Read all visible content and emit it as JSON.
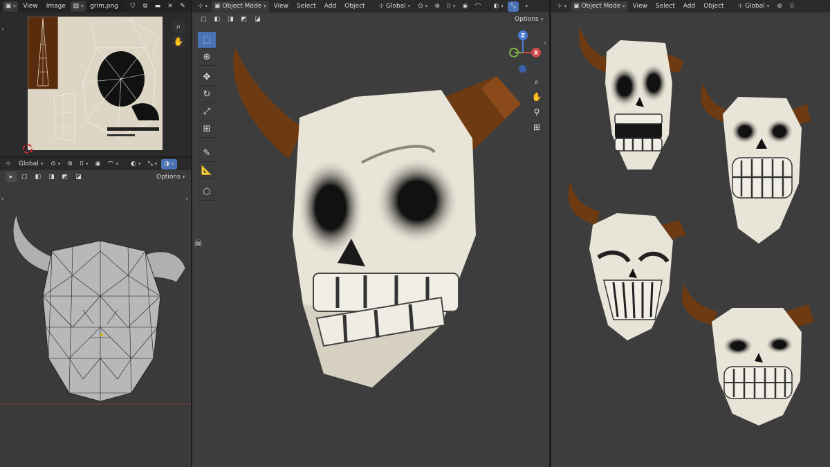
{
  "image_editor": {
    "menu": [
      "View",
      "Image"
    ],
    "image_name": "grim.png"
  },
  "uv_viewport": {
    "transform_orientation": "Global",
    "options_label": "Options"
  },
  "main_viewport": {
    "mode": "Object Mode",
    "menu": [
      "View",
      "Select",
      "Add",
      "Object"
    ],
    "transform_orientation": "Global",
    "options_label": "Options",
    "gizmo": {
      "z": "Z",
      "x": "X",
      "y": "Y"
    }
  },
  "right_viewport": {
    "mode": "Object Mode",
    "menu": [
      "View",
      "Select",
      "Add",
      "Object"
    ],
    "transform_orientation": "Global"
  },
  "colors": {
    "bone": "#e6e2d6",
    "horn": "#7a3f12",
    "active_blue": "#4a73b5",
    "background": "#303030"
  },
  "icons": [
    "cursor-icon",
    "move-icon",
    "rotate-icon",
    "scale-icon",
    "transform-icon",
    "annotate-icon",
    "measure-icon",
    "add-cube-icon",
    "zoom-icon",
    "hand-icon",
    "camera-icon",
    "grid-icon"
  ]
}
